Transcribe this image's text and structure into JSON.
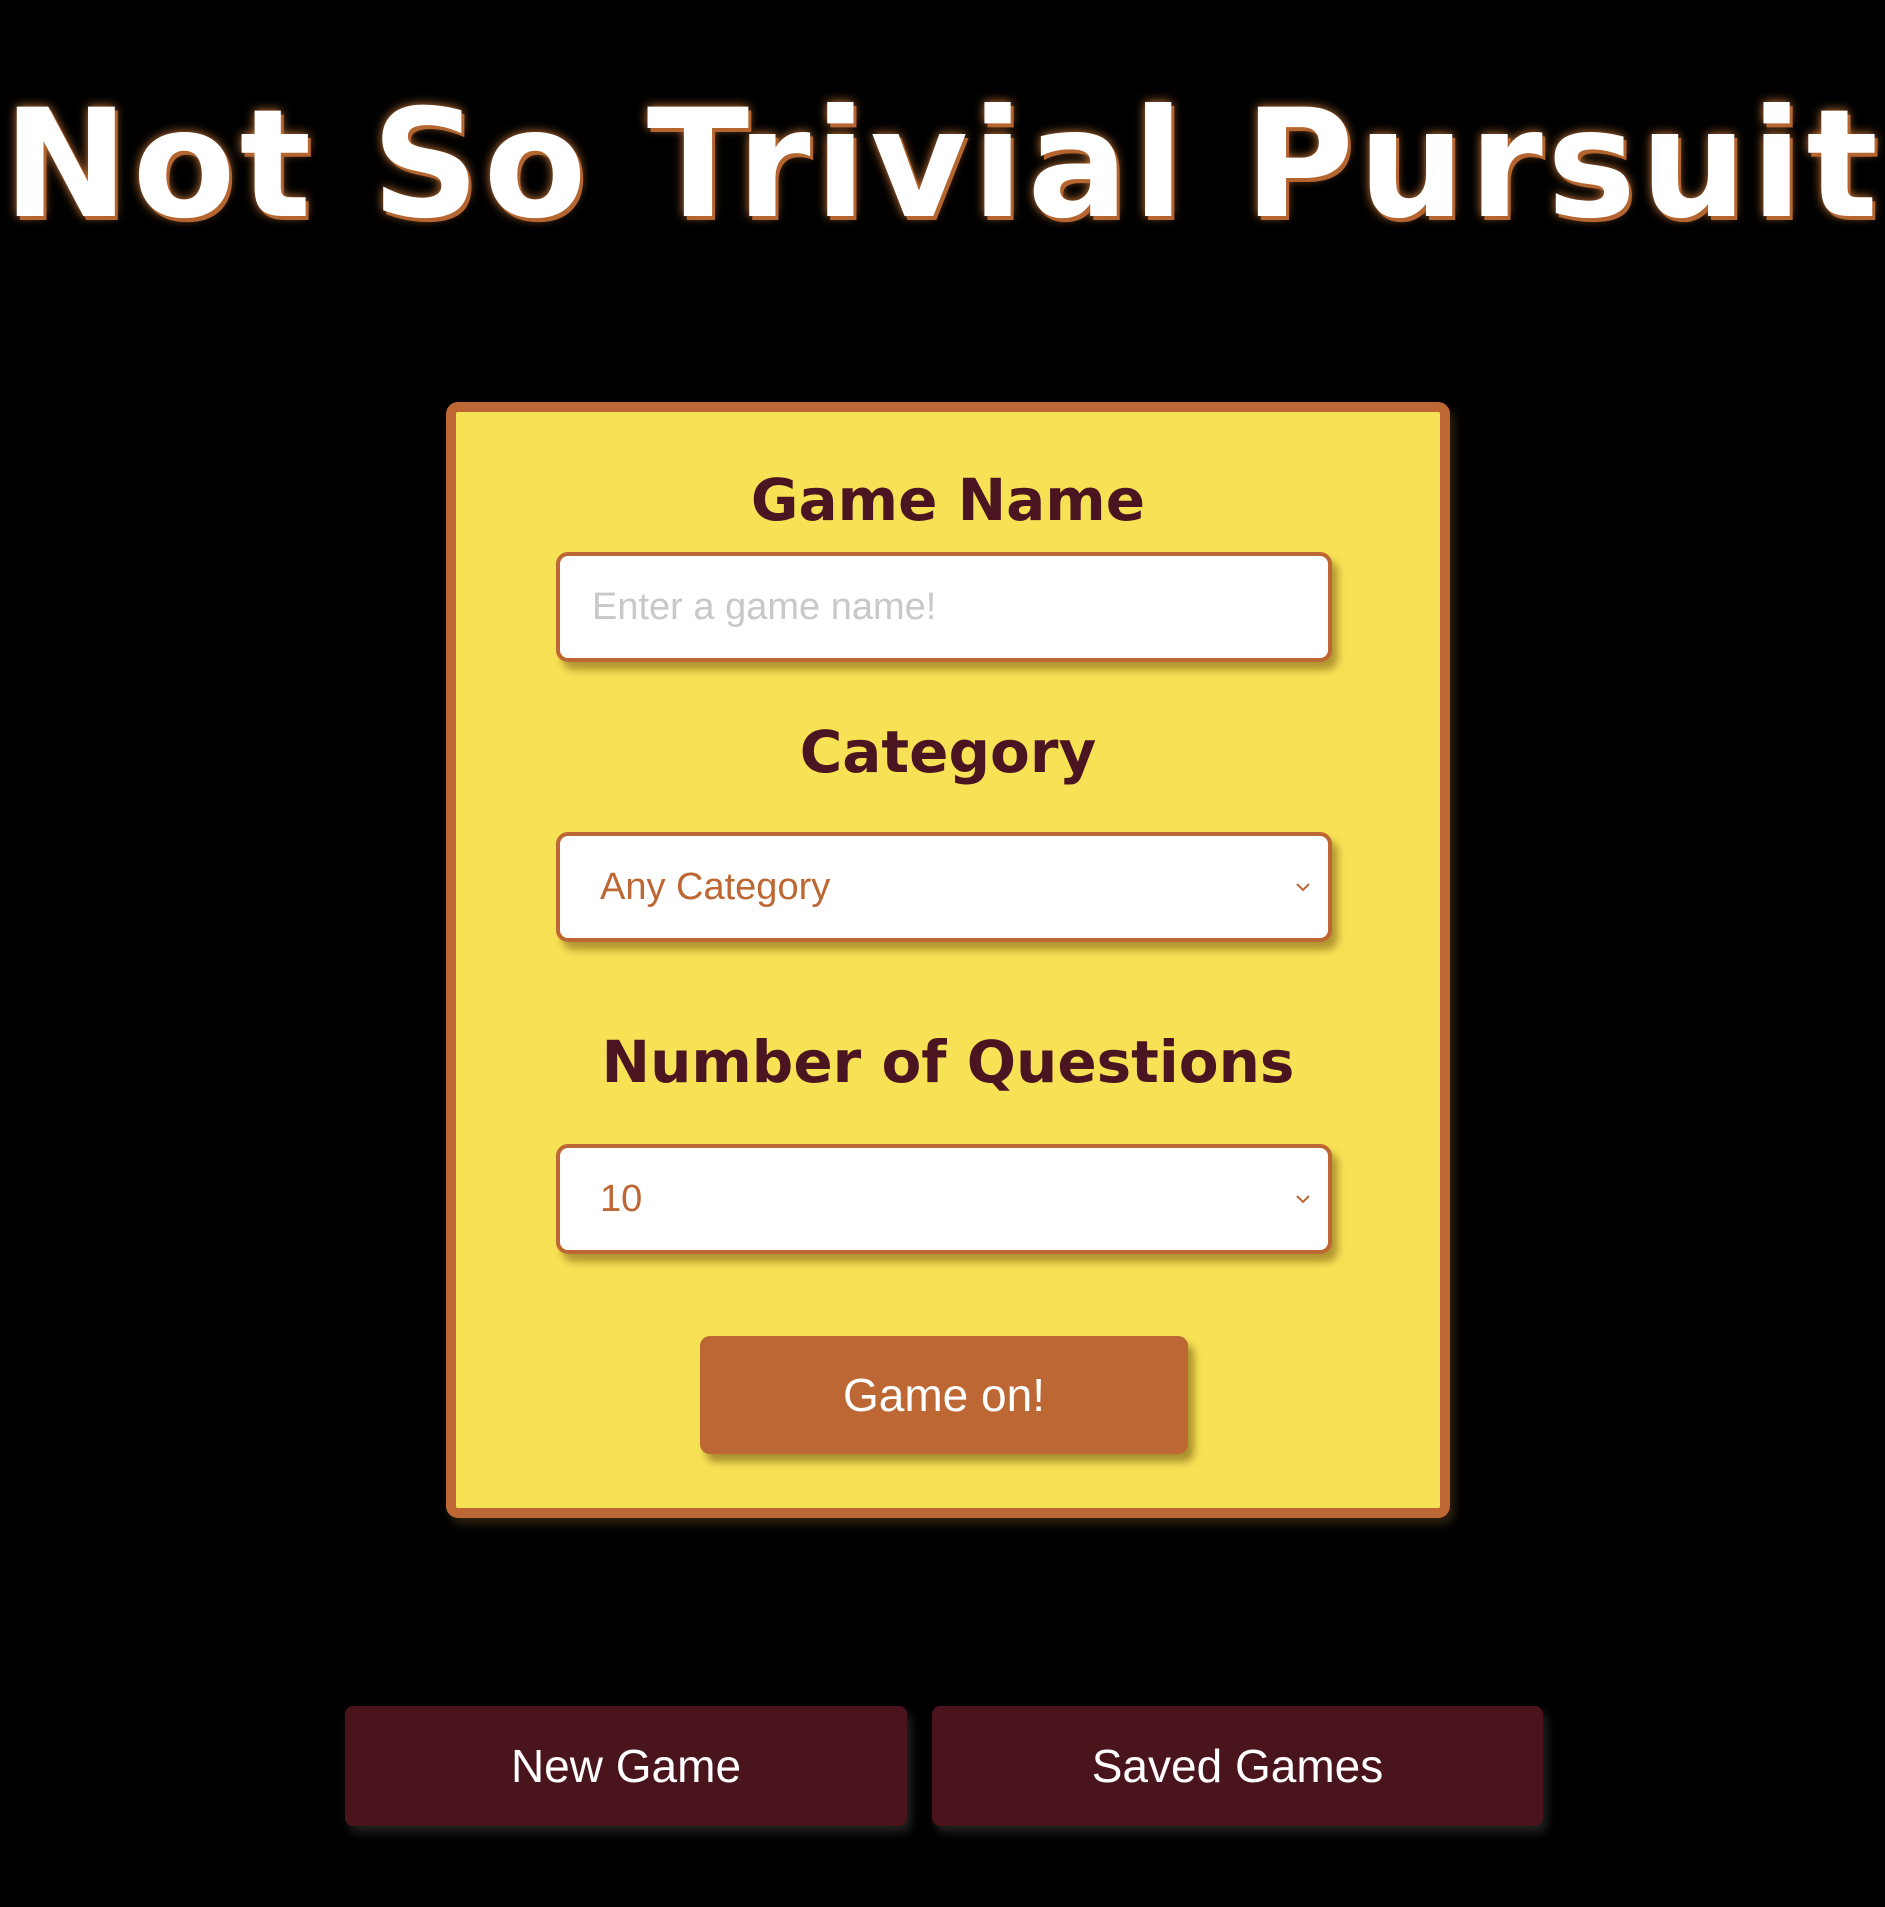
{
  "app": {
    "title": "Not So Trivial Pursuit"
  },
  "form": {
    "game_name": {
      "label": "Game Name",
      "value": "",
      "placeholder": "Enter a game name!"
    },
    "category": {
      "label": "Category",
      "selected": "Any Category"
    },
    "question_count": {
      "label": "Number of Questions",
      "selected": "10"
    },
    "submit_label": "Game on!"
  },
  "nav": {
    "new_game_label": "New Game",
    "saved_games_label": "Saved Games"
  },
  "colors": {
    "background": "#000000",
    "card_fill": "#f7e255",
    "accent": "#bd6834",
    "label_text": "#4a1420",
    "nav_button": "#4a141d"
  },
  "icons": {
    "select_arrow": "chevron-down-icon"
  }
}
